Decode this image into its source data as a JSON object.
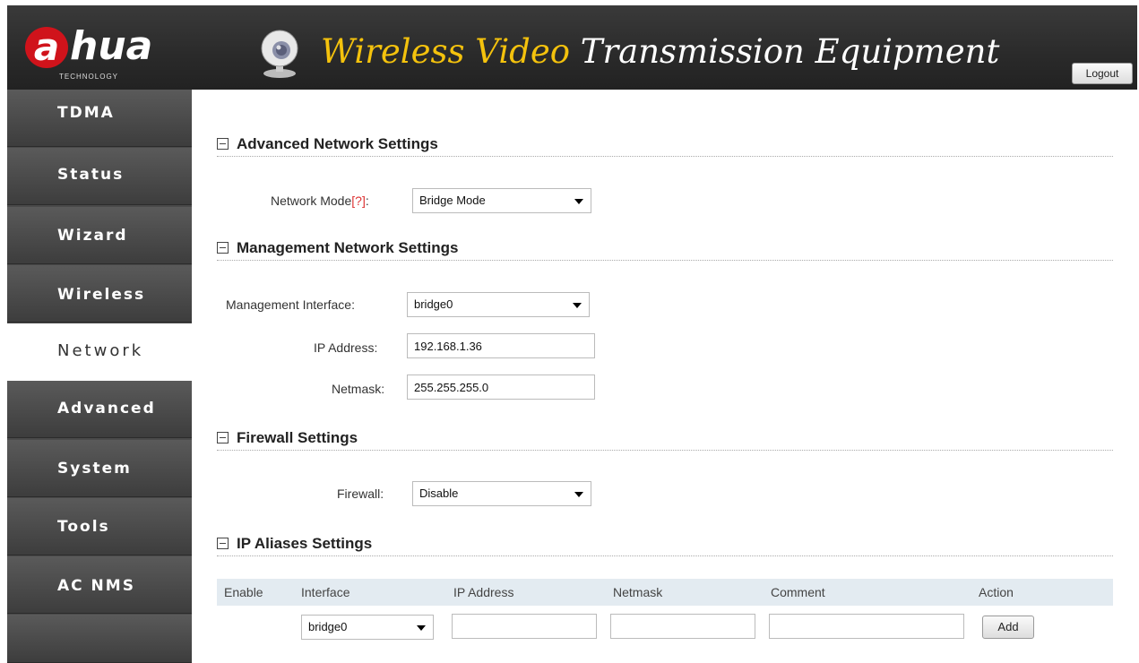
{
  "header": {
    "logo_prefix": "a",
    "logo_rest": "hua",
    "logo_sub": "TECHNOLOGY",
    "title_accent": "Wireless Video",
    "title_rest": " Transmission Equipment",
    "logout_label": "Logout",
    "camera_icon": "webcam-icon"
  },
  "sidebar": {
    "items": [
      {
        "label": "TDMA",
        "active": false
      },
      {
        "label": "Status",
        "active": false
      },
      {
        "label": "Wizard",
        "active": false
      },
      {
        "label": "Wireless",
        "active": false
      },
      {
        "label": "Network",
        "active": true
      },
      {
        "label": "Advanced",
        "active": false
      },
      {
        "label": "System",
        "active": false
      },
      {
        "label": "Tools",
        "active": false
      },
      {
        "label": "AC NMS",
        "active": false
      }
    ]
  },
  "advanced_network": {
    "title": "Advanced Network Settings",
    "network_mode_label": "Network Mode",
    "help_marker": "[?]",
    "label_colon": ":",
    "network_mode_value": "Bridge Mode"
  },
  "management_network": {
    "title": "Management Network Settings",
    "interface_label": "Management Interface:",
    "interface_value": "bridge0",
    "ip_label": "IP Address:",
    "ip_value": "192.168.1.36",
    "netmask_label": "Netmask:",
    "netmask_value": "255.255.255.0"
  },
  "firewall": {
    "title": "Firewall Settings",
    "firewall_label": "Firewall:",
    "firewall_value": "Disable"
  },
  "ip_aliases": {
    "title": "IP Aliases Settings",
    "columns": [
      "Enable",
      "Interface",
      "IP Address",
      "Netmask",
      "Comment",
      "Action"
    ],
    "row": {
      "interface_value": "bridge0",
      "ip_value": "",
      "netmask_value": "",
      "comment_value": "",
      "add_label": "Add"
    }
  },
  "colors": {
    "header_bg": "#2a2a2a",
    "accent_yellow": "#f4c20d",
    "brand_red": "#d0131b",
    "sidebar_bg": "#4a4a4a",
    "help_red": "#dd3333",
    "table_header_bg": "#e3ebf1"
  }
}
